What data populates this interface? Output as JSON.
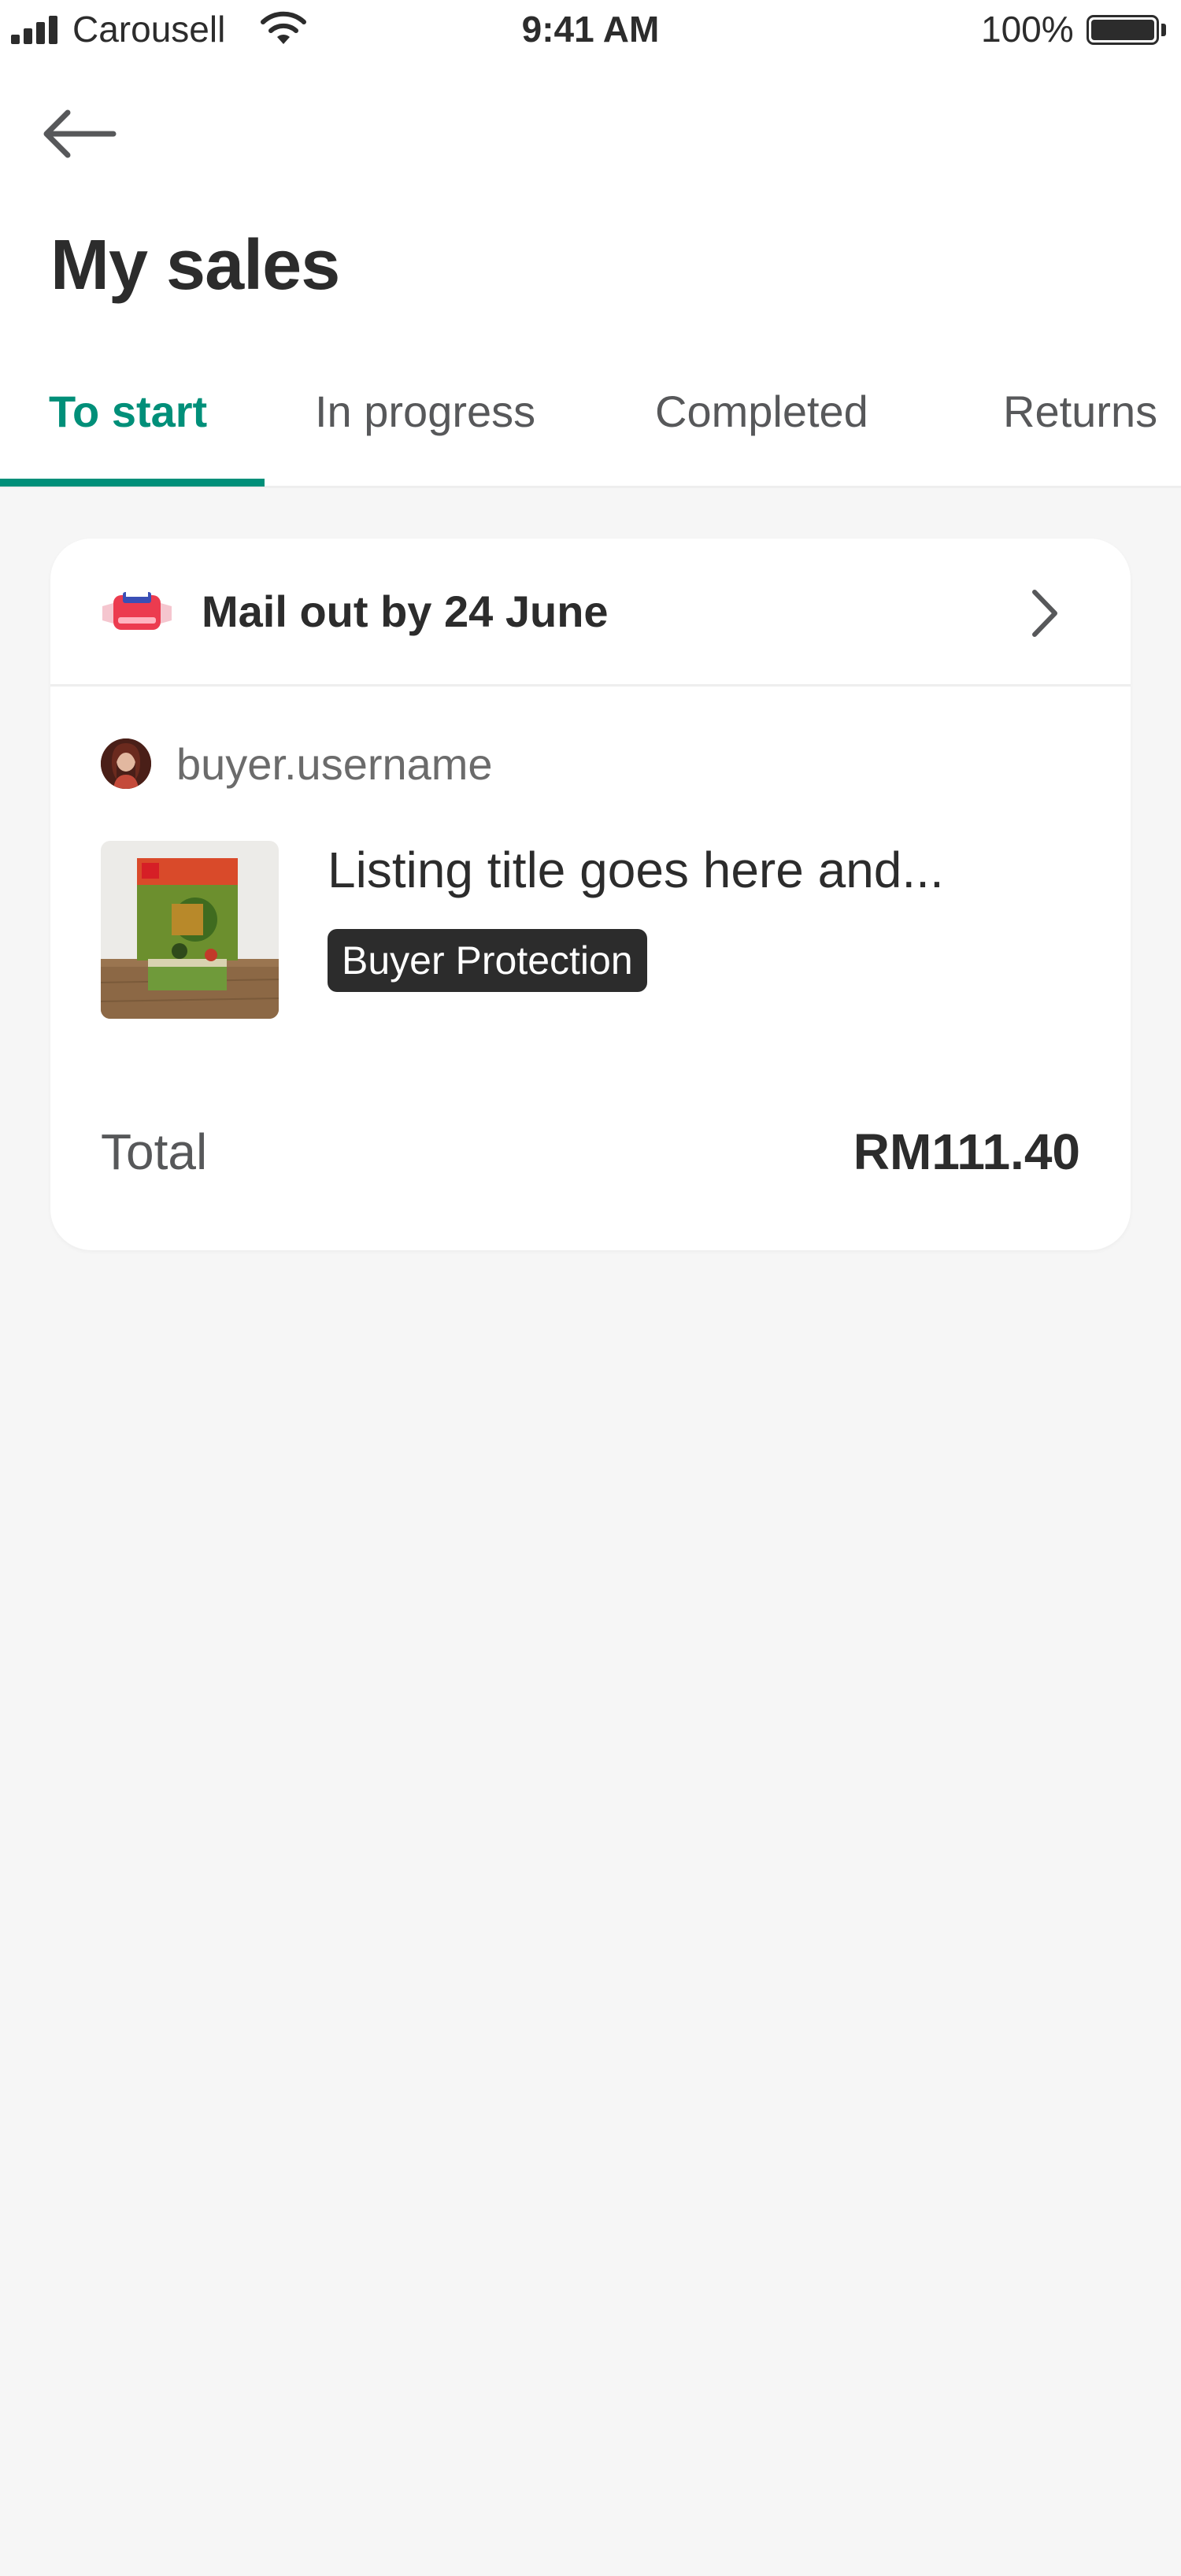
{
  "status_bar": {
    "carrier": "Carousell",
    "time": "9:41 AM",
    "battery": "100%"
  },
  "header": {
    "back_icon": "arrow-left-icon",
    "title": "My sales"
  },
  "tabs": [
    {
      "label": "To start",
      "active": true
    },
    {
      "label": "In progress",
      "active": false
    },
    {
      "label": "Completed",
      "active": false
    },
    {
      "label": "Returns",
      "active": false
    }
  ],
  "colors": {
    "accent": "#008f79",
    "text_primary": "#2c2c2c",
    "text_secondary": "#57585a",
    "background": "#f6f6f6",
    "badge_bg": "#2c2c2c"
  },
  "order": {
    "shipping_icon": "mail-truck-icon",
    "mail_out_text": "Mail out by 24 June",
    "buyer_username": "buyer.username",
    "listing_title": "Listing title goes here and...",
    "badge": "Buyer Protection",
    "total_label": "Total",
    "total_value": "RM111.40"
  }
}
